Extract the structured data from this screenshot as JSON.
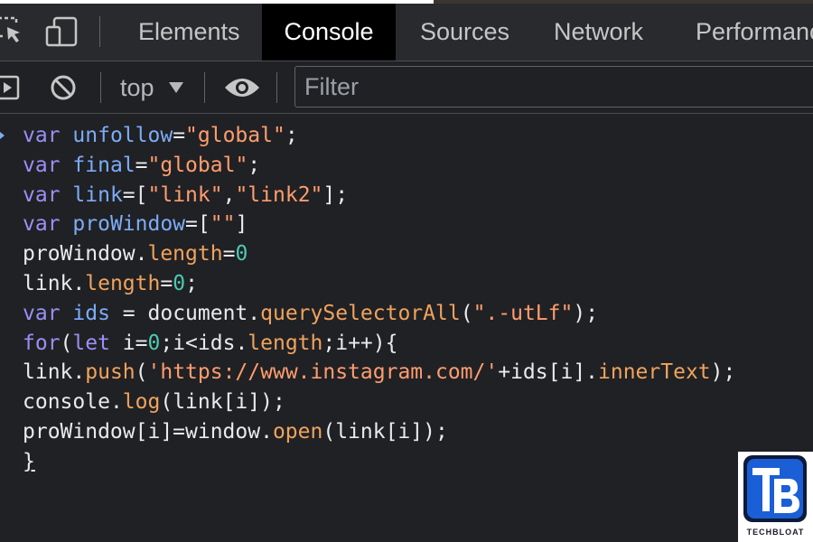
{
  "devtools": {
    "tabs": [
      {
        "label": "Elements",
        "active": false
      },
      {
        "label": "Console",
        "active": true
      },
      {
        "label": "Sources",
        "active": false
      },
      {
        "label": "Network",
        "active": false
      },
      {
        "label": "Performance",
        "active": false
      }
    ],
    "toolbar": {
      "context": "top",
      "filter_placeholder": "Filter"
    }
  },
  "console": {
    "lines": [
      "var unfollow=\"global\";",
      "var final=\"global\";",
      "var link=[\"link\",\"link2\"];",
      "var proWindow=[\"\"]",
      "proWindow.length=0",
      "link.length=0;",
      "var ids = document.querySelectorAll(\".-utLf\");",
      "for(let i=0;i<ids.length;i++){",
      "link.push('https://www.instagram.com/'+ids[i].innerText);",
      "console.log(link[i]);",
      "proWindow[i]=window.open(link[i]);",
      "}"
    ]
  },
  "logo": {
    "text": "TECHBLOAT",
    "colors": {
      "primary": "#1b5fd6",
      "dark": "#0e1a3a"
    }
  },
  "colors": {
    "keyword": "#9b8ff7",
    "variable": "#7cacf8",
    "string": "#ff9d6f",
    "number": "#4cc9b2",
    "property": "#f0a35e",
    "text": "#e8eaed",
    "background": "#202124"
  }
}
